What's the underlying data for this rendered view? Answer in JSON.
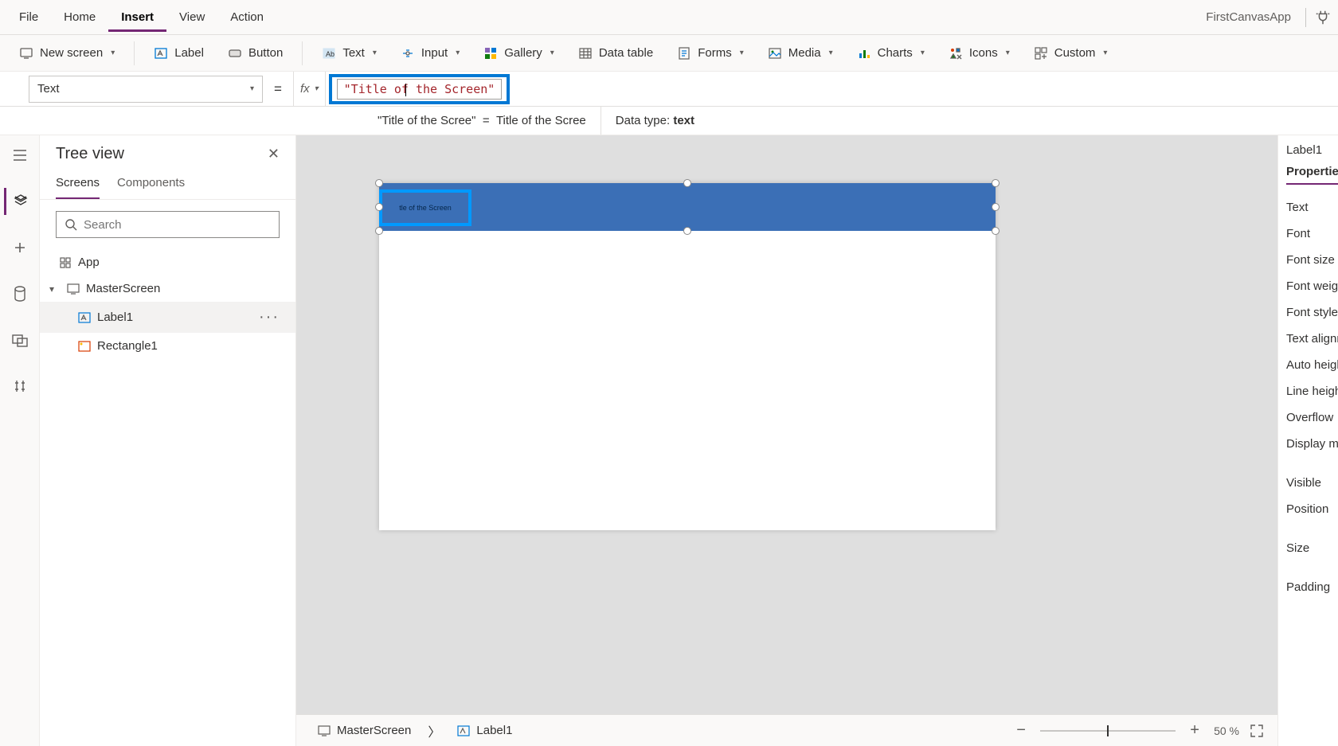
{
  "app_title": "FirstCanvasApp",
  "menubar": {
    "items": [
      "File",
      "Home",
      "Insert",
      "View",
      "Action"
    ],
    "active_index": 2
  },
  "ribbon": {
    "new_screen": "New screen",
    "label": "Label",
    "button": "Button",
    "text": "Text",
    "input": "Input",
    "gallery": "Gallery",
    "data_table": "Data table",
    "forms": "Forms",
    "media": "Media",
    "charts": "Charts",
    "icons": "Icons",
    "custom": "Custom"
  },
  "formula": {
    "property": "Text",
    "equals": "=",
    "fx": "fx",
    "value": "\"Title of the Screen\""
  },
  "result_bar": {
    "lhs": "\"Title of the Scree\"",
    "eq": "=",
    "rhs": "Title of the Scree",
    "datatype_label": "Data type:",
    "datatype_value": "text"
  },
  "tree": {
    "title": "Tree view",
    "tabs": {
      "screens": "Screens",
      "components": "Components"
    },
    "search_placeholder": "Search",
    "app": "App",
    "items": [
      {
        "name": "MasterScreen",
        "type": "screen"
      },
      {
        "name": "Label1",
        "type": "label",
        "selected": true
      },
      {
        "name": "Rectangle1",
        "type": "rect"
      }
    ]
  },
  "canvas": {
    "label_text": "tle of the Screen"
  },
  "breadcrumb": {
    "screen": "MasterScreen",
    "control": "Label1"
  },
  "zoom": {
    "value": "50",
    "unit": "%"
  },
  "props": {
    "selected_name": "Label1",
    "tab": "Properties",
    "rows": [
      "Text",
      "Font",
      "Font size",
      "Font weight",
      "Font style",
      "Text alignm",
      "Auto height",
      "Line height",
      "Overflow",
      "Display mo",
      "",
      "Visible",
      "Position",
      "",
      "Size",
      "",
      "Padding"
    ]
  }
}
